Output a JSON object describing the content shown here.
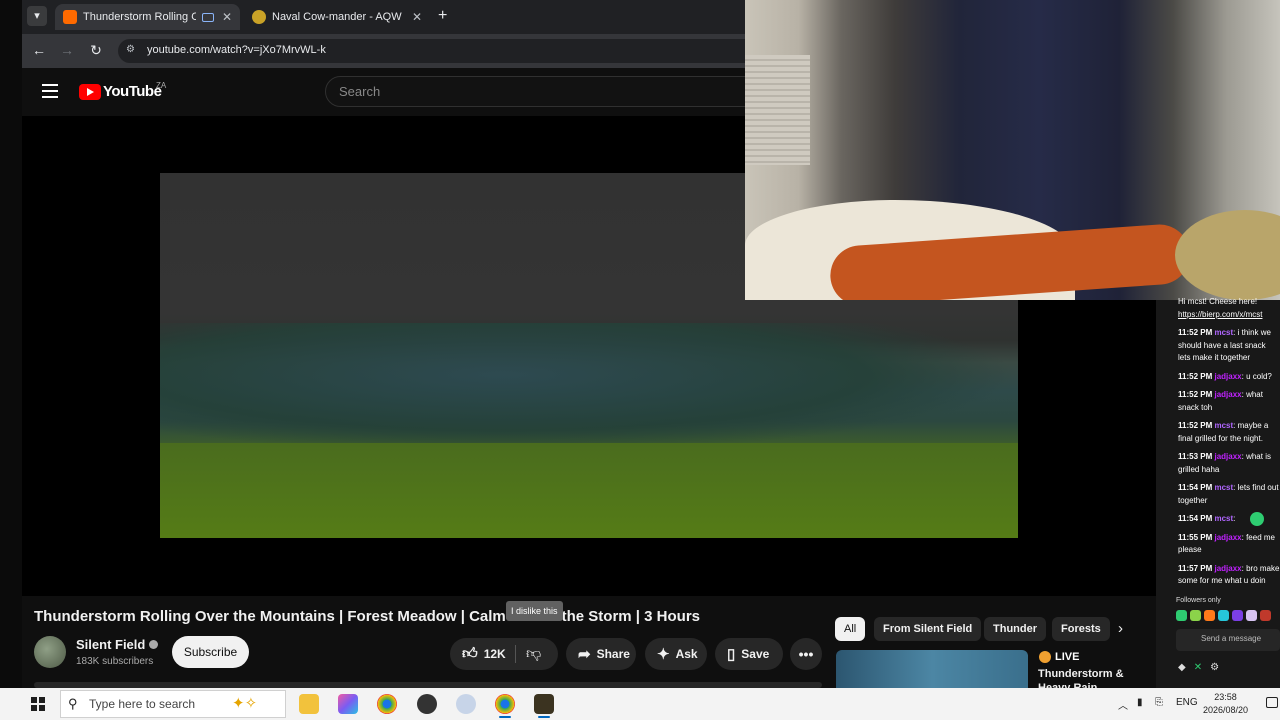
{
  "browser": {
    "tabs": [
      {
        "title": "Thunderstorm Rolling Over",
        "active": true
      },
      {
        "title": "Naval Cow-mander - AQW",
        "active": false
      }
    ],
    "url": "youtube.com/watch?v=jXo7MrvWL-k"
  },
  "youtube": {
    "logo_text": "YouTube",
    "region": "ZA",
    "search_placeholder": "Search",
    "video_title": "Thunderstorm Rolling Over the Mountains | Forest Meadow | Calm Before the Storm | 3 Hours",
    "tooltip": "I dislike this",
    "channel": {
      "name": "Silent Field",
      "subscribers": "183K subscribers",
      "subscribe_label": "Subscribe"
    },
    "actions": {
      "likes": "12K",
      "share": "Share",
      "ask": "Ask",
      "save": "Save"
    },
    "chips": [
      "All",
      "From Silent Field",
      "Thunder",
      "Forests"
    ],
    "recommendation": {
      "live_label": "LIVE",
      "title": "Thunderstorm & Heavy Rain"
    }
  },
  "chat": {
    "top_line": "Hi mcst! Cheese here!",
    "link": "https://bierp.com/x/mcst",
    "messages": [
      {
        "time": "11:52 PM",
        "user": "mcst",
        "role": "streamer",
        "text": "i think we should have a last snack lets make it together"
      },
      {
        "time": "11:52 PM",
        "user": "jadjaxx",
        "role": "viewer",
        "text": "u cold?"
      },
      {
        "time": "11:52 PM",
        "user": "jadjaxx",
        "role": "viewer",
        "text": "what snack toh"
      },
      {
        "time": "11:52 PM",
        "user": "mcst",
        "role": "streamer",
        "text": "maybe a final grilled for the night."
      },
      {
        "time": "11:53 PM",
        "user": "jadjaxx",
        "role": "viewer",
        "text": "what is grilled haha"
      },
      {
        "time": "11:54 PM",
        "user": "mcst",
        "role": "streamer",
        "text": "lets find out together"
      },
      {
        "time": "11:54 PM",
        "user": "mcst",
        "role": "streamer",
        "text": ""
      },
      {
        "time": "11:55 PM",
        "user": "jadjaxx",
        "role": "viewer",
        "text": "feed me please"
      },
      {
        "time": "11:57 PM",
        "user": "jadjaxx",
        "role": "viewer",
        "text": "bro make some for me what u doin"
      }
    ],
    "followers_only": "Followers only",
    "send_placeholder": "Send a message"
  },
  "taskbar": {
    "search_placeholder": "Type here to search",
    "language": "ENG",
    "time": "23:58",
    "date": "2026/08/20"
  }
}
